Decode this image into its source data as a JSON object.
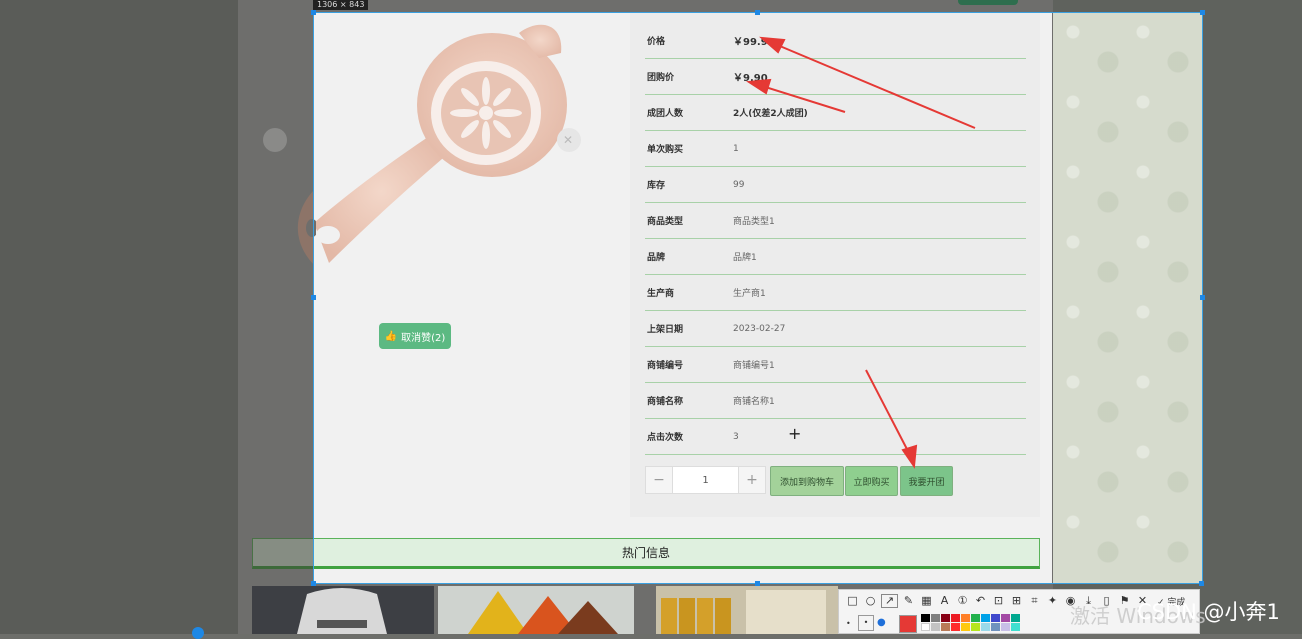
{
  "screen": {
    "capture_size_label": "1306 × 843"
  },
  "product": {
    "like_button": "取消赞(2)",
    "fields": [
      {
        "label": "价格",
        "value": "￥99.9",
        "bold": true
      },
      {
        "label": "团购价",
        "value": "￥9.90",
        "bold": true
      },
      {
        "label": "成团人数",
        "value": "2人(仅差2人成团)",
        "bold": true
      },
      {
        "label": "单次购买",
        "value": "1",
        "bold": false
      },
      {
        "label": "库存",
        "value": "99",
        "bold": false
      },
      {
        "label": "商品类型",
        "value": "商品类型1",
        "bold": false
      },
      {
        "label": "品牌",
        "value": "品牌1",
        "bold": false
      },
      {
        "label": "生产商",
        "value": "生产商1",
        "bold": false
      },
      {
        "label": "上架日期",
        "value": "2023-02-27",
        "bold": false
      },
      {
        "label": "商铺编号",
        "value": "商铺编号1",
        "bold": false
      },
      {
        "label": "商铺名称",
        "value": "商铺名称1",
        "bold": false
      },
      {
        "label": "点击次数",
        "value": "3",
        "bold": false
      }
    ],
    "quantity": {
      "minus": "−",
      "value": "1",
      "plus": "+"
    },
    "actions": {
      "add_to_cart": "添加到购物车",
      "buy_now": "立即购买",
      "start_group": "我要开团"
    }
  },
  "hot_section": {
    "title": "热门信息"
  },
  "toolbar": {
    "done_label": "完成"
  },
  "watermark": {
    "windows": "激活 Windows",
    "csdn": "CSDN @小奔1"
  },
  "colors": {
    "accent_green": "#5cb982",
    "annotation_red": "#e53935",
    "selection_blue": "#3aa0e0"
  }
}
